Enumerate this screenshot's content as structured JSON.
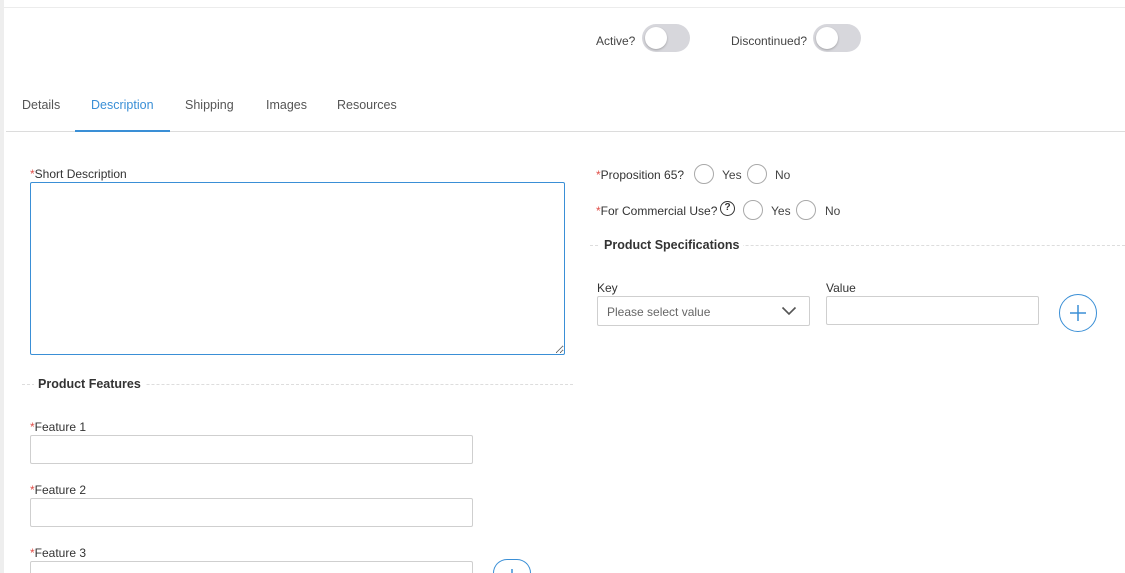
{
  "toggles": {
    "active_label": "Active?",
    "discontinued_label": "Discontinued?"
  },
  "tabs": [
    {
      "label": "Details"
    },
    {
      "label": "Description"
    },
    {
      "label": "Shipping"
    },
    {
      "label": "Images"
    },
    {
      "label": "Resources"
    }
  ],
  "form": {
    "required_marker": "*",
    "short_description": {
      "label": "Short Description",
      "value": ""
    },
    "product_features": {
      "title": "Product Features",
      "features": [
        {
          "label": "Feature 1",
          "value": ""
        },
        {
          "label": "Feature 2",
          "value": ""
        },
        {
          "label": "Feature 3",
          "value": ""
        }
      ]
    },
    "proposition65": {
      "label": "Proposition 65?",
      "yes": "Yes",
      "no": "No"
    },
    "commercial_use": {
      "label": "For Commercial Use?",
      "help_glyph": "?",
      "yes": "Yes",
      "no": "No"
    },
    "product_specifications": {
      "title": "Product Specifications",
      "key_label": "Key",
      "key_placeholder": "Please select value",
      "value_label": "Value",
      "value": ""
    }
  },
  "colors": {
    "accent": "#3a8fd6",
    "required": "#e0504a",
    "toggle_off": "#d7d7dc"
  },
  "icons": {
    "add": "plus-circle-icon",
    "dropdown": "chevron-down-icon",
    "help": "question-circle-icon"
  }
}
